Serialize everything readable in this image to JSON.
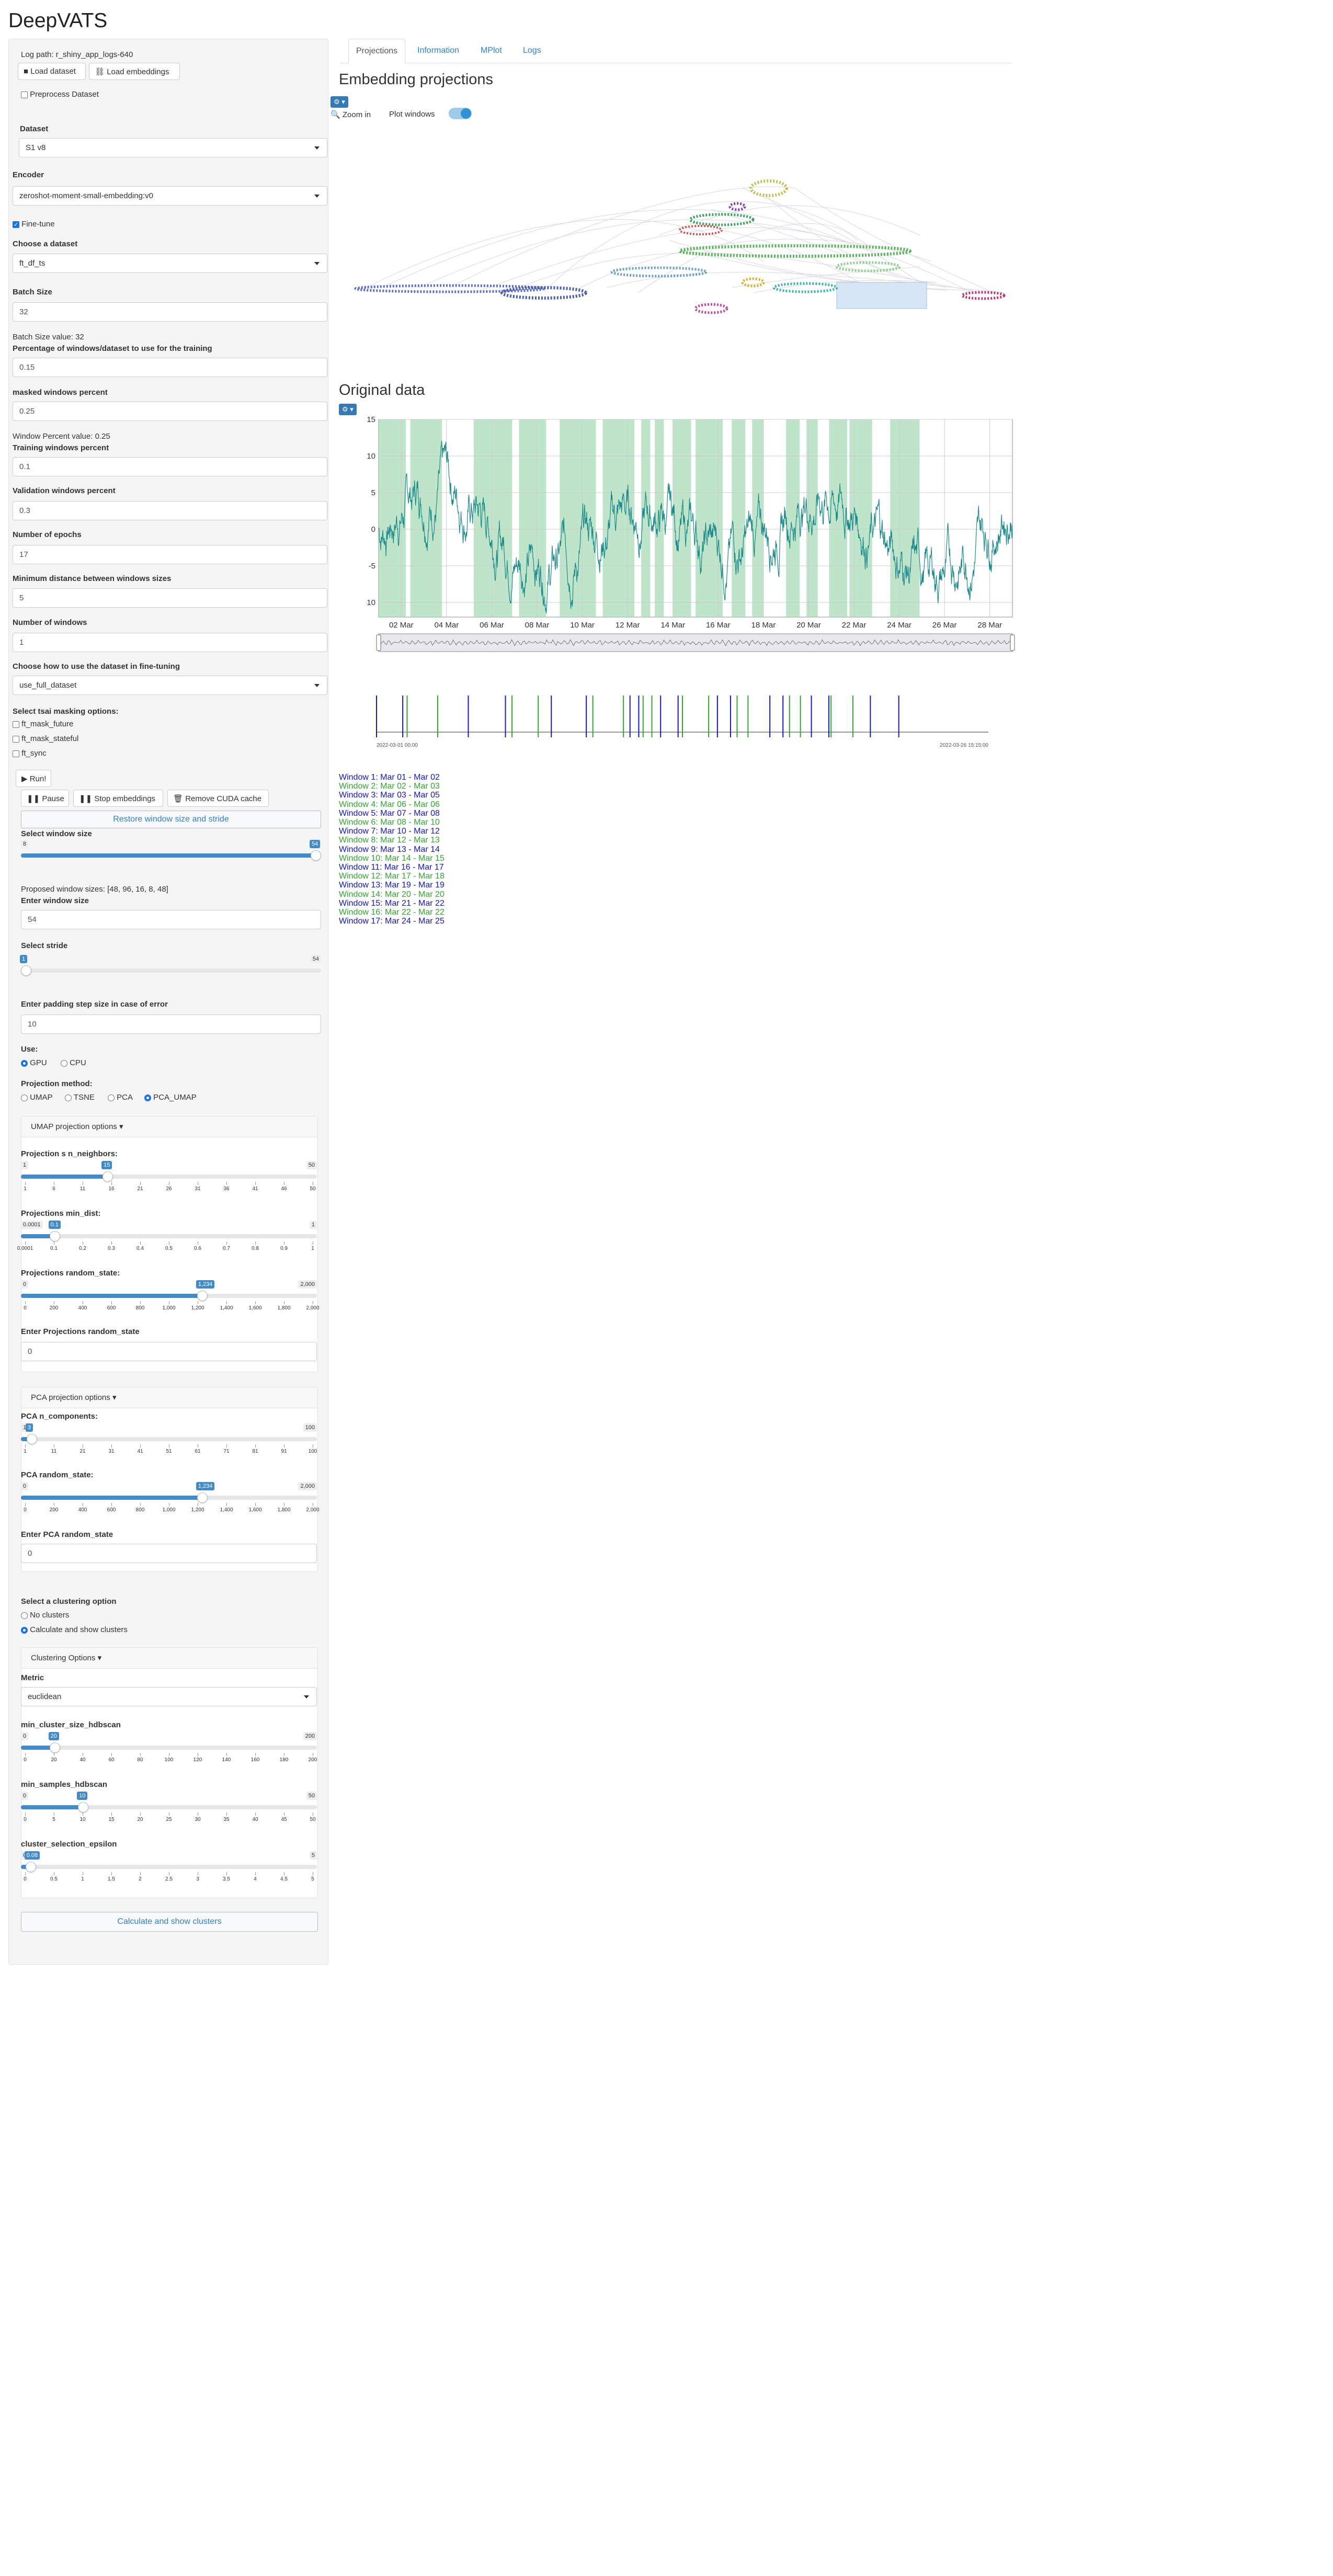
{
  "app": {
    "title": "DeepVATS"
  },
  "sidebar": {
    "log_path": "Log path: r_shiny_app_logs-640",
    "load_dataset": "Load dataset",
    "load_embeddings": "Load embeddings",
    "preprocess": "Preprocess Dataset",
    "dataset_label": "Dataset",
    "dataset_value": "S1 v8",
    "encoder_label": "Encoder",
    "encoder_value": "zeroshot-moment-small-embedding:v0",
    "fine_tune": "Fine-tune",
    "choose_dataset_label": "Choose a dataset",
    "choose_dataset_value": "ft_df_ts",
    "batch_size_label": "Batch Size",
    "batch_size_value": "32",
    "batch_size_note": "Batch Size value: 32",
    "pct_windows_label": "Percentage of windows/dataset to use for the training",
    "pct_windows_value": "0.15",
    "masked_label": "masked windows percent",
    "masked_value": "0.25",
    "window_pct_note": "Window Percent value: 0.25",
    "training_label": "Training windows percent",
    "training_value": "0.1",
    "validation_label": "Validation windows percent",
    "validation_value": "0.3",
    "epochs_label": "Number of epochs",
    "epochs_value": "17",
    "min_distance_label": "Minimum distance between windows sizes",
    "min_distance_value": "5",
    "num_windows_label": "Number of windows",
    "num_windows_value": "1",
    "use_dataset_label": "Choose how to use the dataset in fine-tuning",
    "use_dataset_value": "use_full_dataset",
    "masking_label": "Select tsai masking options:",
    "masking_options": [
      "ft_mask_future",
      "ft_mask_stateful",
      "ft_sync"
    ],
    "run": "Run!",
    "pause": "Pause",
    "stop_embeddings": "Stop embeddings",
    "remove_cuda": "Remove CUDA cache",
    "restore": "Restore window size and stride",
    "window_size_label": "Select window size",
    "proposed_sizes": "Proposed window sizes: [48, 96, 16, 8, 48]",
    "enter_window_label": "Enter window size",
    "enter_window_value": "54",
    "stride_label": "Select stride",
    "padding_label": "Enter padding step size in case of error",
    "padding_value": "10",
    "use_label": "Use:",
    "use_options": [
      "GPU",
      "CPU"
    ],
    "projection_label": "Projection method:",
    "projection_options": [
      "UMAP",
      "TSNE",
      "PCA",
      "PCA_UMAP"
    ],
    "umap_header": "UMAP projection options",
    "n_neighbors_label": "Projection s n_neighbors:",
    "min_dist_label": "Projections min_dist:",
    "random_state_label": "Projections random_state:",
    "enter_random_state_label": "Enter Projections random_state",
    "enter_random_state_value": "0",
    "pca_header": "PCA projection options",
    "pca_components_label": "PCA n_components:",
    "pca_random_state_label": "PCA random_state:",
    "enter_pca_random_label": "Enter PCA random_state",
    "enter_pca_random_value": "0",
    "clustering_label": "Select a clustering option",
    "clustering_options": [
      "No clusters",
      "Calculate and show clusters"
    ],
    "clustering_header": "Clustering Options",
    "metric_label": "Metric",
    "metric_value": "euclidean",
    "min_cluster_label": "min_cluster_size_hdbscan",
    "min_samples_label": "min_samples_hdbscan",
    "epsilon_label": "cluster_selection_epsilon",
    "calc_clusters": "Calculate and show clusters"
  },
  "sliders": {
    "window_size": {
      "min": "8",
      "max": "54",
      "value": "54",
      "frac": 1.0,
      "ticks": []
    },
    "stride": {
      "min": "1",
      "max": "54",
      "value": "1",
      "frac": 0.0,
      "ticks": []
    },
    "n_neighbors": {
      "min": "1",
      "max": "50",
      "value": "15",
      "frac": 0.286,
      "ticks": [
        "1",
        "6",
        "11",
        "16",
        "21",
        "26",
        "31",
        "36",
        "41",
        "46",
        "50"
      ]
    },
    "min_dist": {
      "min": "0.0001",
      "max": "1",
      "value": "0.1",
      "frac": 0.1,
      "ticks": [
        "0.0001",
        "0.1",
        "0.2",
        "0.3",
        "0.4",
        "0.5",
        "0.6",
        "0.7",
        "0.8",
        "0.9",
        "1"
      ]
    },
    "random_state": {
      "min": "0",
      "max": "2,000",
      "value": "1,234",
      "frac": 0.617,
      "ticks": [
        "0",
        "200",
        "400",
        "600",
        "800",
        "1,000",
        "1,200",
        "1,400",
        "1,600",
        "1,800",
        "2,000"
      ]
    },
    "pca_components": {
      "min": "1",
      "max": "100",
      "value": "3",
      "frac": 0.02,
      "ticks": [
        "1",
        "11",
        "21",
        "31",
        "41",
        "51",
        "61",
        "71",
        "81",
        "91",
        "100"
      ]
    },
    "pca_random_state": {
      "min": "0",
      "max": "2,000",
      "value": "1,234",
      "frac": 0.617,
      "ticks": [
        "0",
        "200",
        "400",
        "600",
        "800",
        "1,000",
        "1,200",
        "1,400",
        "1,600",
        "1,800",
        "2,000"
      ]
    },
    "min_cluster": {
      "min": "0",
      "max": "200",
      "value": "20",
      "frac": 0.1,
      "ticks": [
        "0",
        "20",
        "40",
        "60",
        "80",
        "100",
        "120",
        "140",
        "160",
        "180",
        "200"
      ]
    },
    "min_samples": {
      "min": "0",
      "max": "50",
      "value": "10",
      "frac": 0.2,
      "ticks": [
        "0",
        "5",
        "10",
        "15",
        "20",
        "25",
        "30",
        "35",
        "40",
        "45",
        "50"
      ]
    },
    "epsilon": {
      "min": "0",
      "max": "5",
      "value": "0.08",
      "frac": 0.016,
      "ticks": [
        "0",
        "0.5",
        "1",
        "1.5",
        "2",
        "2.5",
        "3",
        "3.5",
        "4",
        "4.5",
        "5"
      ]
    }
  },
  "main": {
    "tabs": [
      "Projections",
      "Information",
      "MPlot",
      "Logs"
    ],
    "embedding_title": "Embedding projections",
    "gear": "⚙ ▾",
    "zoom_in": "Zoom in",
    "plot_windows": "Plot windows",
    "original_title": "Original data",
    "timeline_start": "2022-03-01 00:00",
    "timeline_end": "2022-03-26 15:15:00",
    "windows": [
      "Window 1: Mar 01 - Mar 02",
      "Window 2: Mar 02 - Mar 03",
      "Window 3: Mar 03 - Mar 05",
      "Window 4: Mar 06 - Mar 06",
      "Window 5: Mar 07 - Mar 08",
      "Window 6: Mar 08 - Mar 10",
      "Window 7: Mar 10 - Mar 12",
      "Window 8: Mar 12 - Mar 13",
      "Window 9: Mar 13 - Mar 14",
      "Window 10: Mar 14 - Mar 15",
      "Window 11: Mar 16 - Mar 17",
      "Window 12: Mar 17 - Mar 18",
      "Window 13: Mar 19 - Mar 19",
      "Window 14: Mar 20 - Mar 20",
      "Window 15: Mar 21 - Mar 22",
      "Window 16: Mar 22 - Mar 22",
      "Window 17: Mar 24 - Mar 25"
    ],
    "window_colors": [
      "#1414d8",
      "#2fa82f"
    ]
  },
  "chart_data": {
    "type": "line",
    "title": "Original data",
    "x_ticks": [
      "02 Mar",
      "04 Mar",
      "06 Mar",
      "08 Mar",
      "10 Mar",
      "12 Mar",
      "14 Mar",
      "16 Mar",
      "18 Mar",
      "20 Mar",
      "22 Mar",
      "24 Mar",
      "26 Mar",
      "28 Mar"
    ],
    "y_ticks": [
      15,
      10,
      5,
      0,
      -5,
      -10
    ],
    "ylim": [
      -12,
      15
    ],
    "xlim_days": [
      1,
      29
    ],
    "line_color": "#1a8a8a",
    "highlight_color": "#a8dbb8",
    "highlight_ranges_days": [
      [
        1.0,
        2.2
      ],
      [
        2.4,
        3.8
      ],
      [
        5.2,
        6.9
      ],
      [
        7.2,
        8.4
      ],
      [
        9.0,
        10.6
      ],
      [
        10.9,
        12.3
      ],
      [
        12.6,
        13.0
      ],
      [
        13.2,
        13.6
      ],
      [
        14.0,
        14.8
      ],
      [
        15.0,
        16.2
      ],
      [
        16.6,
        17.2
      ],
      [
        17.5,
        18.0
      ],
      [
        19.0,
        19.6
      ],
      [
        19.9,
        20.4
      ],
      [
        20.9,
        21.7
      ],
      [
        21.8,
        22.8
      ],
      [
        23.6,
        24.9
      ]
    ],
    "grid": true
  }
}
